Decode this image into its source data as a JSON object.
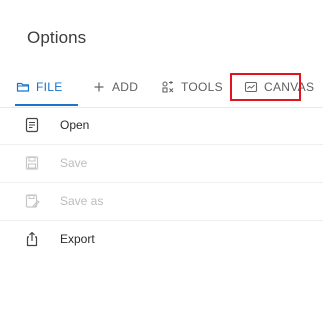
{
  "title": "Options",
  "tabs": [
    {
      "label": "FILE",
      "icon": "folder-icon",
      "active": true
    },
    {
      "label": "ADD",
      "icon": "plus-icon",
      "active": false
    },
    {
      "label": "TOOLS",
      "icon": "tools-icon",
      "active": false
    },
    {
      "label": "CANVAS",
      "icon": "canvas-icon",
      "active": false
    }
  ],
  "menu": [
    {
      "label": "Open",
      "icon": "open-file-icon",
      "enabled": true
    },
    {
      "label": "Save",
      "icon": "save-icon",
      "enabled": false
    },
    {
      "label": "Save as",
      "icon": "save-as-icon",
      "enabled": false
    },
    {
      "label": "Export",
      "icon": "export-icon",
      "enabled": true
    }
  ],
  "colors": {
    "accent": "#1b74c9",
    "highlight": "#e0141c"
  }
}
